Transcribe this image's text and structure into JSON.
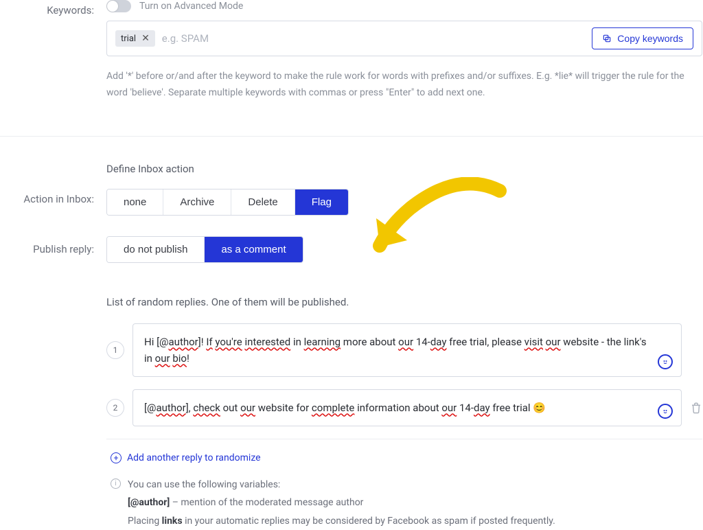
{
  "keywords": {
    "label": "Keywords:",
    "toggle_label": "Turn on Advanced Mode",
    "chip": "trial",
    "placeholder": "e.g. SPAM",
    "copy_btn": "Copy keywords",
    "help": "Add '*' before or/and after the keyword to make the rule work for words with prefixes and/or suffixes. E.g. *lie* will trigger the rule for the word 'believe'. Separate multiple keywords with commas or press \"Enter\" to add next one."
  },
  "action": {
    "heading": "Define Inbox action",
    "label": "Action in Inbox:",
    "options": [
      "none",
      "Archive",
      "Delete",
      "Flag"
    ],
    "selected": "Flag"
  },
  "publish": {
    "label": "Publish reply:",
    "options": [
      "do not publish",
      "as a comment"
    ],
    "selected": "as a comment"
  },
  "replies": {
    "heading": "List of random replies. One of them will be published.",
    "items": [
      {
        "num": "1",
        "segments": [
          {
            "t": "Hi [@",
            "u": false
          },
          {
            "t": "author",
            "u": true
          },
          {
            "t": "]! ",
            "u": false
          },
          {
            "t": "If",
            "u": true
          },
          {
            "t": " ",
            "u": false
          },
          {
            "t": "you're",
            "u": true
          },
          {
            "t": " ",
            "u": false
          },
          {
            "t": "interested",
            "u": true
          },
          {
            "t": " in ",
            "u": false
          },
          {
            "t": "learning",
            "u": true
          },
          {
            "t": " more about ",
            "u": false
          },
          {
            "t": "our",
            "u": true
          },
          {
            "t": " 14-",
            "u": false
          },
          {
            "t": "day",
            "u": true
          },
          {
            "t": " free trial, please ",
            "u": false
          },
          {
            "t": "visit",
            "u": true
          },
          {
            "t": " ",
            "u": false
          },
          {
            "t": "our",
            "u": true
          },
          {
            "t": " website - the link's in ",
            "u": false
          },
          {
            "t": "our",
            "u": true
          },
          {
            "t": " ",
            "u": false
          },
          {
            "t": "bio",
            "u": true
          },
          {
            "t": "!",
            "u": false
          }
        ],
        "emoji": "",
        "deletable": false
      },
      {
        "num": "2",
        "segments": [
          {
            "t": "[@",
            "u": false
          },
          {
            "t": "author",
            "u": true
          },
          {
            "t": "], ",
            "u": false
          },
          {
            "t": "check",
            "u": true
          },
          {
            "t": " out ",
            "u": false
          },
          {
            "t": "our",
            "u": true
          },
          {
            "t": " website for ",
            "u": false
          },
          {
            "t": "complete",
            "u": true
          },
          {
            "t": " information about ",
            "u": false
          },
          {
            "t": "our",
            "u": true
          },
          {
            "t": " 14-",
            "u": false
          },
          {
            "t": "day",
            "u": true
          },
          {
            "t": " free trial ",
            "u": false
          }
        ],
        "emoji": "😊",
        "deletable": true
      }
    ],
    "add_link": "Add another reply to randomize",
    "info_lead": "You can use the following variables:",
    "info_var": "[@author]",
    "info_var_desc": " – mention of the moderated message author",
    "info_links_pre": "Placing ",
    "info_links_bold": "links",
    "info_links_post": " in your automatic replies may be considered by Facebook as spam if posted frequently."
  }
}
